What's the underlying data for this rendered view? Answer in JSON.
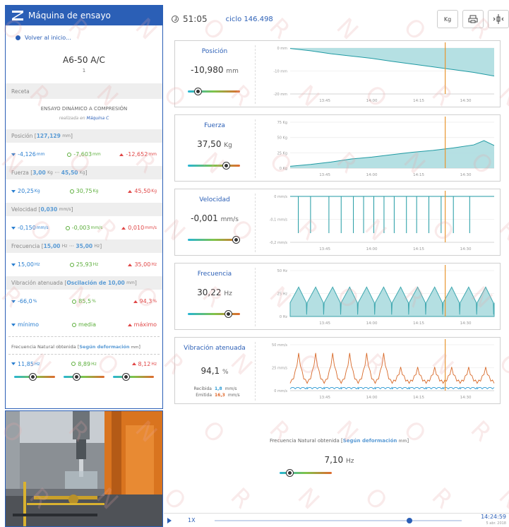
{
  "app": {
    "title": "Máquina de ensayo",
    "back_link": "Volver al inicio..."
  },
  "machine": {
    "model": "A6-50 A/C",
    "unit_number": "1"
  },
  "recipe": {
    "header": "Receta",
    "name": "ENSAYO DINÁMICO A COMPRESIÓN",
    "performed_prefix": "realizada en",
    "performed_machine": "Máquina C"
  },
  "sections": [
    {
      "label": "Posición",
      "range": "127,129",
      "range_unit": "mm",
      "min": "-4,126",
      "avg": "-7,603",
      "max": "-12,652",
      "unit": "mm"
    },
    {
      "label": "Fuerza",
      "range": "3,00",
      "range_unit": "Kg",
      "range_to": "45,50",
      "range_to_unit": "Kg",
      "min": "20,25",
      "avg": "30,75",
      "max": "45,50",
      "unit": "Kg"
    },
    {
      "label": "Velocidad",
      "range": "0,030",
      "range_unit": "mm/s",
      "min": "-0,150",
      "avg": "-0,003",
      "max": "0,010",
      "unit": "mm/s"
    },
    {
      "label": "Frecuencia",
      "range": "15,00",
      "range_unit": "Hz",
      "range_to": "35,00",
      "range_to_unit": "Hz",
      "min": "15,00",
      "avg": "25,93",
      "max": "35,00",
      "unit": "Hz"
    },
    {
      "label": "Vibración atenuada",
      "range": "Oscilación de 10,00",
      "range_unit": "mm",
      "min": "-66,0",
      "avg": "85,5",
      "max": "94,3",
      "unit": "%"
    }
  ],
  "legend": {
    "min": "mínimo",
    "avg": "media",
    "max": "máximo"
  },
  "natural_freq": {
    "label": "Frecuencia Natural obtenida",
    "bracket": "Según deformación",
    "bracket_unit": "mm",
    "min": "11,85",
    "avg": "8,89",
    "max": "8,12",
    "unit": "Hz",
    "value": "7,10",
    "value_unit": "Hz"
  },
  "topbar": {
    "time": "51:05",
    "cycle": "ciclo 146.498",
    "unit_button": "Kg"
  },
  "panels": [
    {
      "title": "Posición",
      "value": "-10,980",
      "unit": "mm",
      "slider": 0.15
    },
    {
      "title": "Fuerza",
      "value": "37,50",
      "unit": "Kg",
      "slider": 0.75
    },
    {
      "title": "Velocidad",
      "value": "-0,001",
      "unit": "mm/s",
      "slider": 0.97
    },
    {
      "title": "Frecuencia",
      "value": "30,22",
      "unit": "Hz",
      "slider": 0.8
    },
    {
      "title": "Vibración atenuada",
      "value": "94,1",
      "unit": "%",
      "slider": null,
      "received_label": "Recibida",
      "received_value": "1,8",
      "received_unit": "mm/s",
      "emitted_label": "Emitida",
      "emitted_value": "16,3",
      "emitted_unit": "mm/s"
    }
  ],
  "playbar": {
    "speed": "1X",
    "time": "14:24:59",
    "date": "5 abr. 2018",
    "progress": 0.78
  },
  "watermark": "NOR",
  "colors": {
    "accent": "#2b5fb6",
    "fill": "#a8dade",
    "line": "#1f9aa3",
    "cursor": "#e8962f",
    "orange": "#d86a2a"
  },
  "chart_data": [
    {
      "type": "area",
      "name": "Posición",
      "x_ticks": [
        "13:45",
        "14:00",
        "14:15",
        "14:30"
      ],
      "y_ticks": [
        "0 mm",
        "-10 mm",
        "-20 mm"
      ],
      "ylim": [
        -20,
        0
      ],
      "x": [
        0,
        0.1,
        0.2,
        0.3,
        0.4,
        0.5,
        0.6,
        0.7,
        0.8,
        0.9,
        1.0
      ],
      "y": [
        -0.2,
        -1.2,
        -2.5,
        -3.5,
        -4.5,
        -5.8,
        -7.0,
        -8.2,
        -9.4,
        -10.6,
        -12.2
      ]
    },
    {
      "type": "area",
      "name": "Fuerza",
      "x_ticks": [
        "13:45",
        "14:00",
        "14:15",
        "14:30"
      ],
      "y_ticks": [
        "75 Kg",
        "50 Kg",
        "25 Kg",
        "0 Kg"
      ],
      "ylim": [
        0,
        75
      ],
      "x": [
        0,
        0.1,
        0.2,
        0.3,
        0.4,
        0.5,
        0.6,
        0.7,
        0.8,
        0.9,
        0.95,
        1.0
      ],
      "y": [
        3,
        6,
        10,
        15,
        18,
        22,
        26,
        29,
        33,
        38,
        45,
        37
      ]
    },
    {
      "type": "line",
      "name": "Velocidad",
      "x_ticks": [
        "13:45",
        "14:00",
        "14:15",
        "14:30"
      ],
      "y_ticks": [
        "0 mm/s",
        "-0,1 mm/s",
        "-0,2 mm/s"
      ],
      "ylim": [
        -0.2,
        0
      ],
      "spikes_x": [
        0.04,
        0.1,
        0.19,
        0.25,
        0.31,
        0.36,
        0.41,
        0.46,
        0.51,
        0.57,
        0.62,
        0.68,
        0.74,
        0.8,
        0.88
      ],
      "spike_min": -0.16
    },
    {
      "type": "area",
      "name": "Frecuencia",
      "x_ticks": [
        "13:45",
        "14:00",
        "14:15",
        "14:30"
      ],
      "y_ticks": [
        "50 Hz",
        "25 Hz",
        "0 Hz"
      ],
      "ylim": [
        0,
        50
      ],
      "periods": 12,
      "peak": 32,
      "trough": 15
    },
    {
      "type": "line",
      "name": "Vibración atenuada",
      "x_ticks": [
        "13:45",
        "14:00",
        "14:15",
        "14:30"
      ],
      "y_ticks": [
        "50 mm/s",
        "25 mm/s",
        "0 mm/s"
      ],
      "ylim": [
        0,
        50
      ],
      "periods": 12,
      "orange_peak": 38,
      "orange_base": 8,
      "blue_level": 2
    }
  ]
}
